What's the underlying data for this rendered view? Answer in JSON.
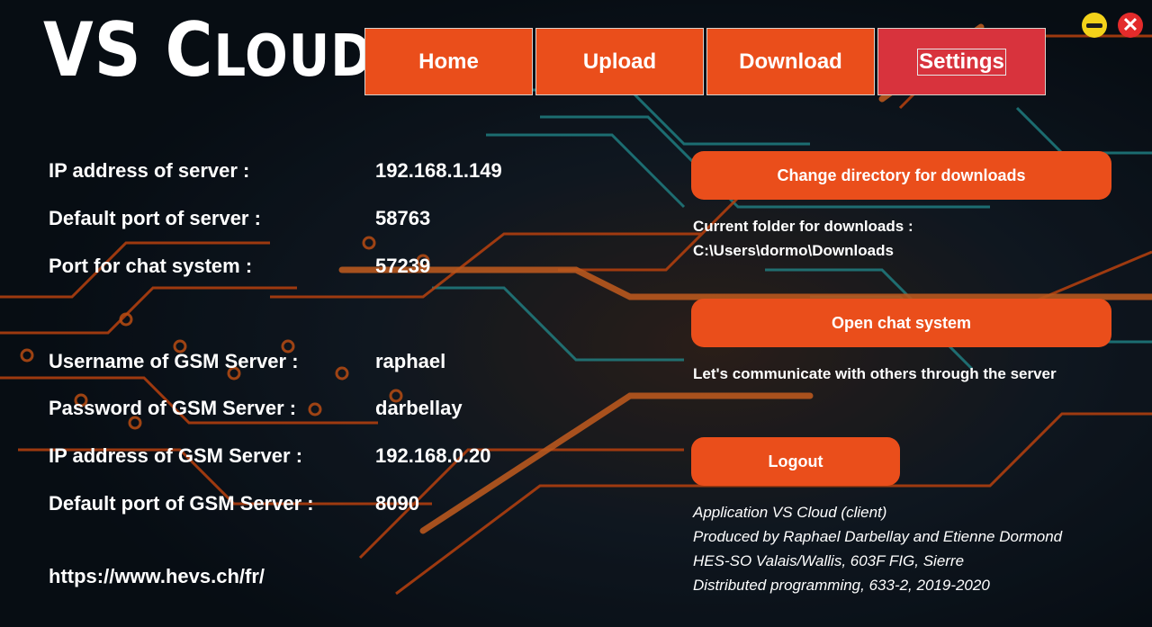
{
  "app": {
    "logo_part1": "VS C",
    "logo_part2": "LOUD"
  },
  "nav": {
    "home": "Home",
    "upload": "Upload",
    "download": "Download",
    "settings": "Settings"
  },
  "window": {
    "minimize_glyph": "",
    "close_glyph": "✕"
  },
  "server_info": [
    {
      "label": "IP address of server :",
      "value": "192.168.1.149"
    },
    {
      "label": "Default port of server :",
      "value": "58763"
    },
    {
      "label": "Port for chat system :",
      "value": "57239"
    }
  ],
  "gsm_info": [
    {
      "label": "Username of GSM Server :",
      "value": "raphael"
    },
    {
      "label": "Password of GSM Server :",
      "value": "darbellay"
    },
    {
      "label": "IP address of GSM Server :",
      "value": "192.168.0.20"
    },
    {
      "label": "Default port of GSM Server :",
      "value": "8090"
    }
  ],
  "link": "https://www.hevs.ch/fr/",
  "downloads": {
    "button": "Change directory for downloads",
    "current_label": "Current folder for downloads :",
    "current_path": "C:\\Users\\dormo\\Downloads"
  },
  "chat": {
    "button": "Open chat system",
    "caption": "Let's communicate with others through the server"
  },
  "logout": "Logout",
  "credits": [
    "Application VS Cloud (client)",
    "Produced by Raphael Darbellay and Etienne Dormond",
    "HES-SO Valais/Wallis, 603F FIG, Sierre",
    "Distributed programming, 633-2, 2019-2020"
  ],
  "colors": {
    "accent": "#ea4e1b",
    "active_tab": "#d8333d",
    "minimize": "#f3d21a",
    "close": "#e32b2b"
  }
}
